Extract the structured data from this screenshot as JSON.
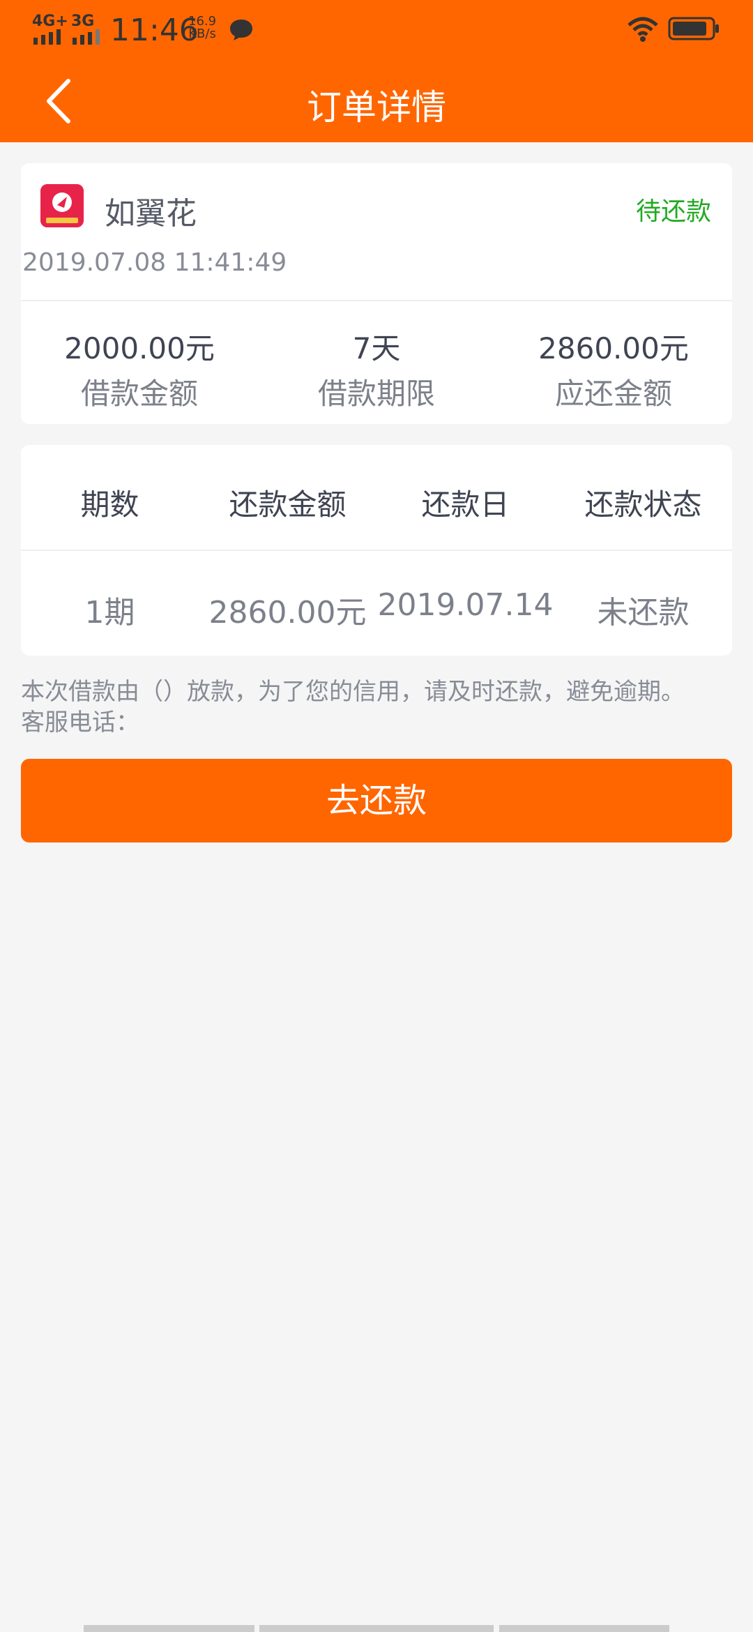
{
  "status_bar": {
    "network1": "4G+",
    "network2": "3G",
    "time": "11:46",
    "speed_value": "16.9",
    "speed_unit": "KB/s"
  },
  "nav": {
    "title": "订单详情"
  },
  "order": {
    "app_name": "如翼花",
    "status": "待还款",
    "date": "2019.07.08 11:41:49",
    "stats": [
      {
        "value": "2000.00元",
        "label": "借款金额"
      },
      {
        "value": "7天",
        "label": "借款期限"
      },
      {
        "value": "2860.00元",
        "label": "应还金额"
      }
    ]
  },
  "schedule": {
    "headers": [
      "期数",
      "还款金额",
      "还款日",
      "还款状态"
    ],
    "rows": [
      [
        "1期",
        "2860.00元",
        "2019.07.14",
        "未还款"
      ]
    ]
  },
  "notice": {
    "line1": "本次借款由（）放款，为了您的信用，请及时还款，避免逾期。",
    "line2": "客服电话："
  },
  "actions": {
    "repay_label": "去还款"
  },
  "colors": {
    "brand": "#ff6600",
    "status_pending": "#22aa22"
  }
}
